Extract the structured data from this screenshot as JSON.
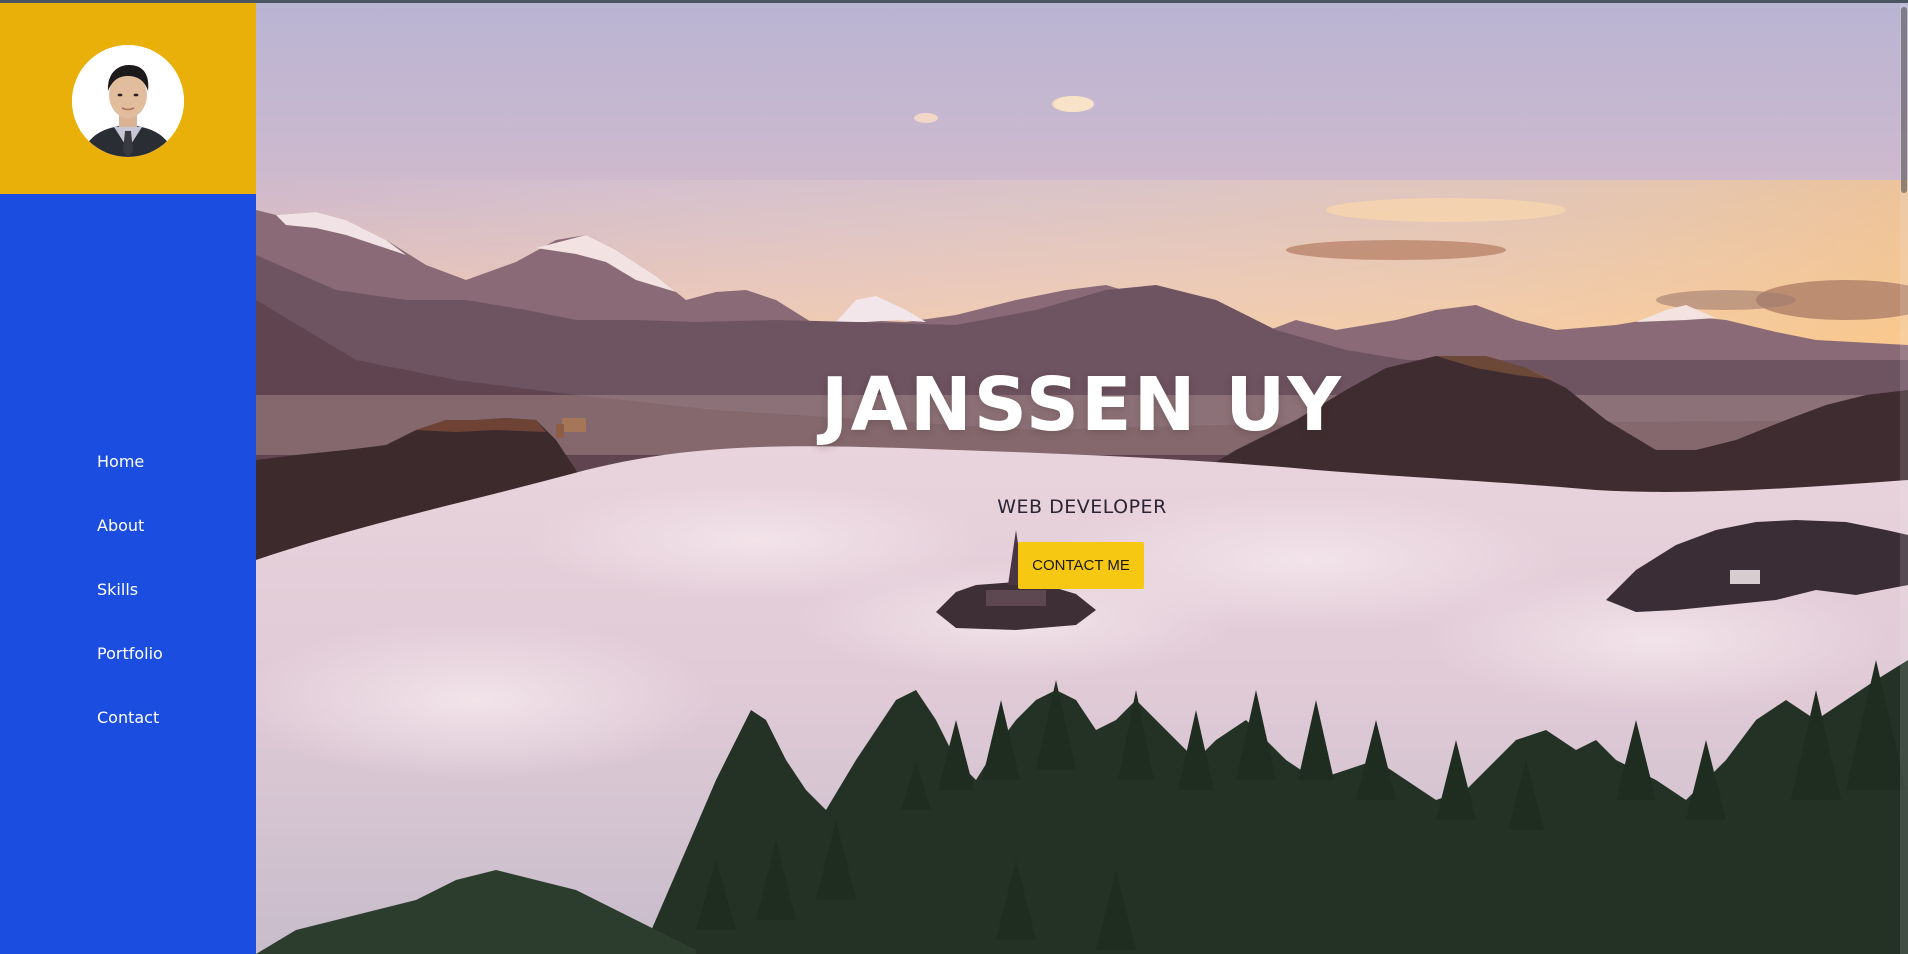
{
  "profile": {
    "avatar_icon": "person-portrait-icon"
  },
  "sidebar": {
    "items": [
      {
        "label": "Home"
      },
      {
        "label": "About"
      },
      {
        "label": "Skills"
      },
      {
        "label": "Portfolio"
      },
      {
        "label": "Contact"
      }
    ]
  },
  "hero": {
    "name": "JANSSEN UY",
    "role": "WEB DEVELOPER",
    "cta_label": "CONTACT ME"
  },
  "colors": {
    "sidebar_bg": "#1b4ee0",
    "profile_bg": "#e8b008",
    "cta_bg": "#f6c812"
  }
}
